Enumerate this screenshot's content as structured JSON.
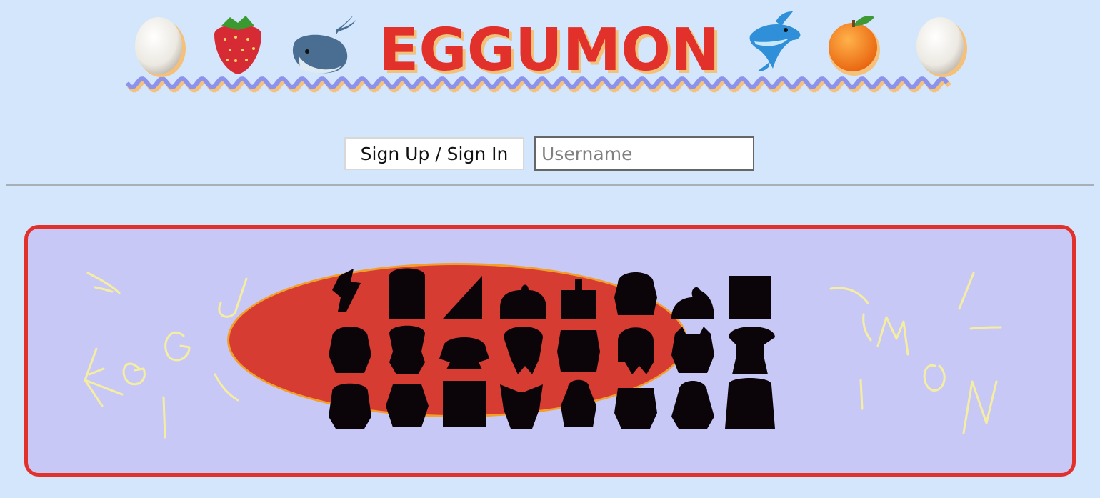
{
  "header": {
    "title": "EGGUMON",
    "decor_left": [
      "egg-icon",
      "strawberry-icon",
      "whale-icon"
    ],
    "decor_right": [
      "dolphin-icon",
      "orange-icon",
      "egg-icon"
    ]
  },
  "auth": {
    "button_label": "Sign Up / Sign In",
    "username_placeholder": "Username",
    "username_value": ""
  },
  "banner": {
    "left_scribble": "EGGU",
    "right_scribble": "MON",
    "silhouette_count": 24
  },
  "colors": {
    "background": "#d3e6fb",
    "title": "#e2302a",
    "wave": "#8b93ec",
    "banner_bg": "#c8c8f6",
    "banner_border": "#e2302a",
    "ellipse": "#d73c33",
    "silhouette": "#0b0509",
    "scribble": "#f5eea0"
  }
}
